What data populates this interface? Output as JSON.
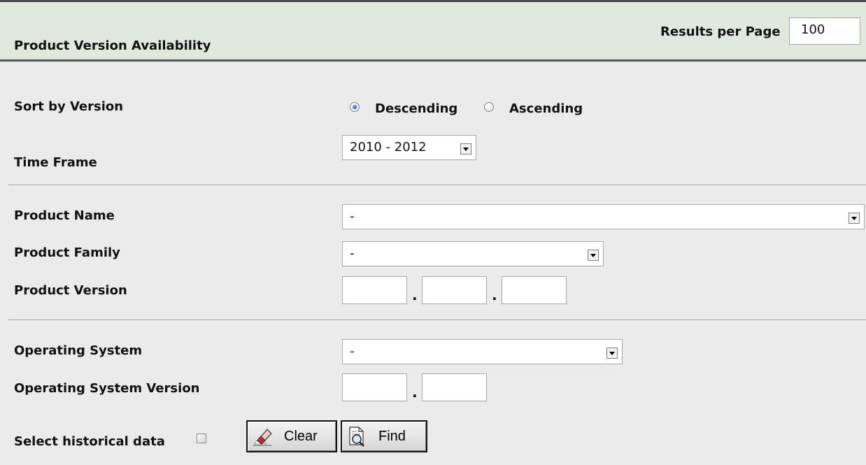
{
  "header": {
    "title": "Product Version Availability",
    "results_per_page_label": "Results per Page",
    "results_per_page_value": "100"
  },
  "sort": {
    "label": "Sort by Version",
    "options": [
      "Descending",
      "Ascending"
    ],
    "selected": "Descending"
  },
  "time_frame": {
    "label": "Time Frame",
    "value": "2010 - 2012"
  },
  "product": {
    "name_label": "Product Name",
    "name_value": "-",
    "family_label": "Product Family",
    "family_value": "-",
    "version_label": "Product Version",
    "version_separator": "."
  },
  "os": {
    "label": "Operating System",
    "value": "-",
    "version_label": "Operating System Version",
    "version_separator": "."
  },
  "historical": {
    "label": "Select historical data",
    "checked": false
  },
  "buttons": {
    "clear_label": "Clear",
    "find_label": "Find"
  }
}
